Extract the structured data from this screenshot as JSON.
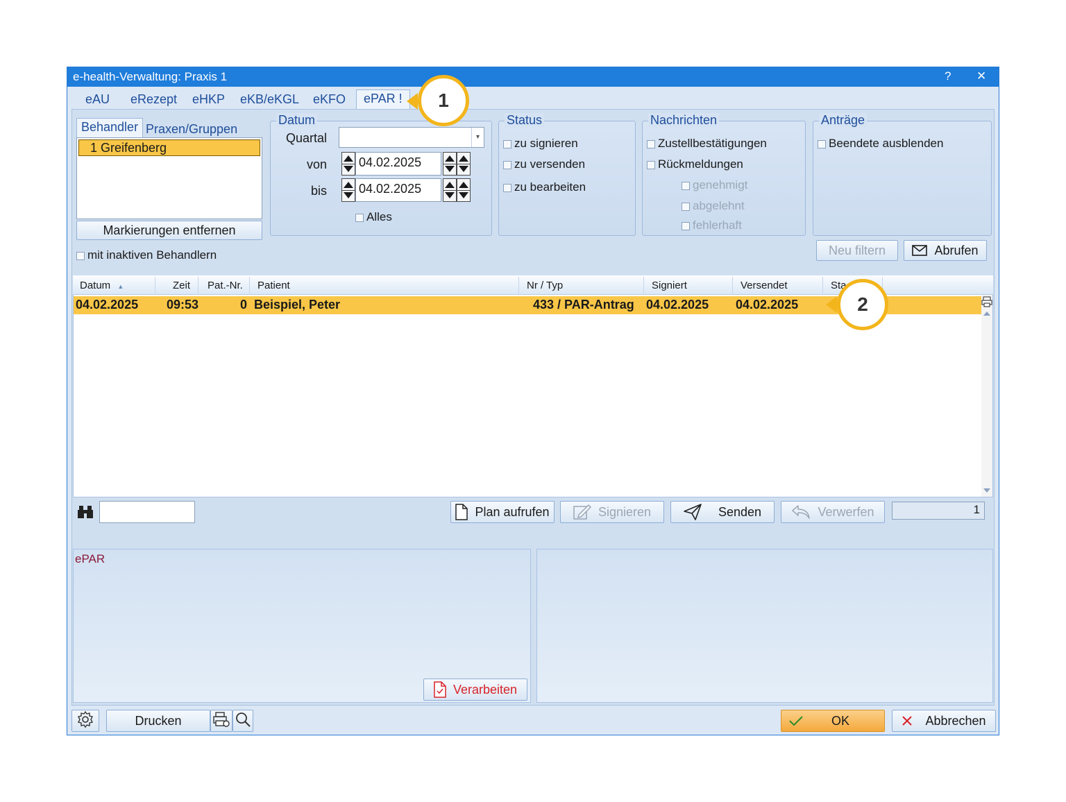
{
  "window": {
    "title": "e-health-Verwaltung: Praxis 1",
    "help_label": "?",
    "close_label": "✕"
  },
  "tabs": [
    {
      "label": "eAU"
    },
    {
      "label": "eRezept"
    },
    {
      "label": "eHKP"
    },
    {
      "label": "eKB/eKGL"
    },
    {
      "label": "eKFO"
    },
    {
      "label": "ePAR !"
    }
  ],
  "behandler": {
    "tab_behandler": "Behandler",
    "tab_praxen": "Praxen/Gruppen",
    "items": [
      "1 Greifenberg"
    ],
    "clear_button": "Markierungen entfernen",
    "inactive_label": "mit inaktiven Behandlern"
  },
  "datum": {
    "legend": "Datum",
    "quartal_label": "Quartal",
    "quartal_value": "",
    "von_label": "von",
    "von_value": "04.02.2025",
    "bis_label": "bis",
    "bis_value": "04.02.2025",
    "alles_label": "Alles"
  },
  "status": {
    "legend": "Status",
    "options": [
      "zu signieren",
      "zu versenden",
      "zu bearbeiten"
    ]
  },
  "nachrichten": {
    "legend": "Nachrichten",
    "options": [
      "Zustellbestätigungen",
      "Rückmeldungen"
    ],
    "sub_options": [
      "genehmigt",
      "abgelehnt",
      "fehlerhaft"
    ]
  },
  "antraege": {
    "legend": "Anträge",
    "options": [
      "Beendete ausblenden"
    ],
    "neu_filtern": "Neu filtern",
    "abrufen": "Abrufen"
  },
  "grid": {
    "columns": [
      "Datum",
      "Zeit",
      "Pat.-Nr.",
      "Patient",
      "Nr / Typ",
      "Signiert",
      "Versendet",
      "Sta"
    ],
    "sort_indicator": "▲",
    "rows": [
      {
        "datum": "04.02.2025",
        "zeit": "09:53",
        "patnr": "0",
        "patient": "Beispiel, Peter",
        "nrtyp": "433 / PAR-Antrag",
        "signiert": "04.02.2025",
        "versendet": "04.02.2025",
        "status": ""
      }
    ]
  },
  "actions": {
    "search_value": "",
    "plan_aufrufen": "Plan aufrufen",
    "signieren": "Signieren",
    "senden": "Senden",
    "verwerfen": "Verwerfen",
    "count": "1"
  },
  "detail": {
    "left_label": "ePAR",
    "verarbeiten": "Verarbeiten"
  },
  "footer": {
    "drucken": "Drucken",
    "ok": "OK",
    "abbrechen": "Abbrechen"
  },
  "callouts": [
    "1",
    "2"
  ],
  "colors": {
    "titlebar": "#1f7ddb",
    "selection": "#f9c647",
    "callout_ring": "#f3b51c",
    "ok_button": "#f7b548",
    "verarbeiten_text": "#d8232a",
    "epar_label": "#8b1a3a"
  },
  "icons": [
    "settings-gear-icon",
    "printer-icon",
    "search-icon",
    "binoculars-icon",
    "document-icon",
    "pencil-icon",
    "send-icon",
    "undo-icon",
    "envelope-icon",
    "pdf-icon",
    "check-icon",
    "cross-icon"
  ]
}
